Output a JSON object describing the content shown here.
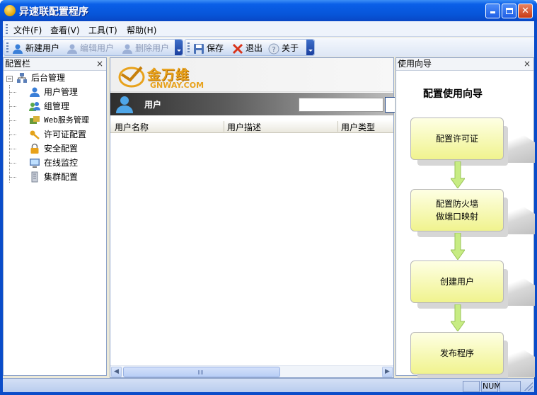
{
  "window": {
    "title": "异速联配置程序"
  },
  "menu": {
    "items": [
      {
        "label": "文件(F)"
      },
      {
        "label": "查看(V)"
      },
      {
        "label": "工具(T)"
      },
      {
        "label": "帮助(H)"
      }
    ]
  },
  "toolbar1": {
    "buttons": [
      {
        "label": "新建用户",
        "icon": "new-user-icon",
        "enabled": true
      },
      {
        "label": "编辑用户",
        "icon": "edit-user-icon",
        "enabled": false
      },
      {
        "label": "删除用户",
        "icon": "delete-user-icon",
        "enabled": false
      }
    ]
  },
  "toolbar2": {
    "buttons": [
      {
        "label": "保存",
        "icon": "save-icon"
      },
      {
        "label": "退出",
        "icon": "exit-icon"
      },
      {
        "label": "关于",
        "icon": "about-icon"
      }
    ]
  },
  "left_pane": {
    "title": "配置栏",
    "close": "×",
    "tree": {
      "root": {
        "label": "后台管理",
        "icon": "server-network-icon"
      },
      "children": [
        {
          "label": "用户管理",
          "icon": "user-icon"
        },
        {
          "label": "组管理",
          "icon": "group-icon"
        },
        {
          "label": "Web服务管理",
          "icon": "web-service-icon"
        },
        {
          "label": "许可证配置",
          "icon": "key-icon"
        },
        {
          "label": "安全配置",
          "icon": "lock-icon"
        },
        {
          "label": "在线监控",
          "icon": "monitor-icon"
        },
        {
          "label": "集群配置",
          "icon": "cluster-icon"
        }
      ]
    }
  },
  "center_pane": {
    "logo_cn": "金万维",
    "logo_en": "GNWAY.COM",
    "section_title": "用户",
    "search_value": "",
    "columns": [
      "用户名称",
      "用户描述",
      "用户类型"
    ],
    "rows": []
  },
  "right_pane": {
    "title": "使用向导",
    "close": "×",
    "heading": "配置使用向导",
    "steps": [
      {
        "line1": "配置许可证",
        "line2": ""
      },
      {
        "line1": "配置防火墙",
        "line2": "做端口映射"
      },
      {
        "line1": "创建用户",
        "line2": ""
      },
      {
        "line1": "发布程序",
        "line2": ""
      }
    ]
  },
  "statusbar": {
    "num": "NUM"
  },
  "colors": {
    "titlebar": "#0755D8",
    "guide_box": "#F0F38E",
    "guide_arrow": "#C7EC83",
    "logo": "#E8A21C"
  }
}
